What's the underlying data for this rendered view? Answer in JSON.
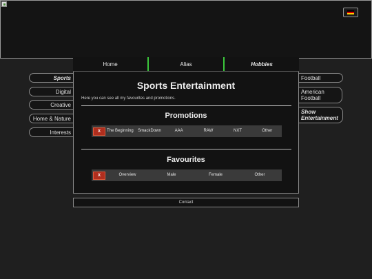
{
  "header": {
    "flag_colors": [
      "#000000",
      "#dd0000",
      "#ffce00"
    ]
  },
  "topnav": {
    "items": [
      {
        "label": "Home"
      },
      {
        "label": "Alias"
      },
      {
        "label": "Hobbies"
      }
    ]
  },
  "left_nav": {
    "items": [
      {
        "label": "Sports"
      },
      {
        "label": "Digital"
      },
      {
        "label": "Creative"
      },
      {
        "label": "Home & Nature"
      },
      {
        "label": "Interests"
      }
    ]
  },
  "right_nav": {
    "items": [
      {
        "label": "Football"
      },
      {
        "label": "American Football"
      },
      {
        "label": "Show Entertainment"
      }
    ]
  },
  "main": {
    "title": "Sports Entertainment",
    "intro": "Here you can see all my favourites and promotions.",
    "promotions": {
      "title": "Promotions",
      "close_label": "X",
      "tabs": [
        "The Beginning",
        "SmackDown",
        "AAA",
        "RAW",
        "NXT",
        "Other"
      ]
    },
    "favourites": {
      "title": "Favourites",
      "close_label": "X",
      "tabs": [
        "Overview",
        "Male",
        "Female",
        "Other"
      ]
    }
  },
  "footer": {
    "contact_label": "Contact"
  },
  "colors": {
    "accent_divider": "#3cc83c",
    "close_button": "#b02e1e"
  }
}
